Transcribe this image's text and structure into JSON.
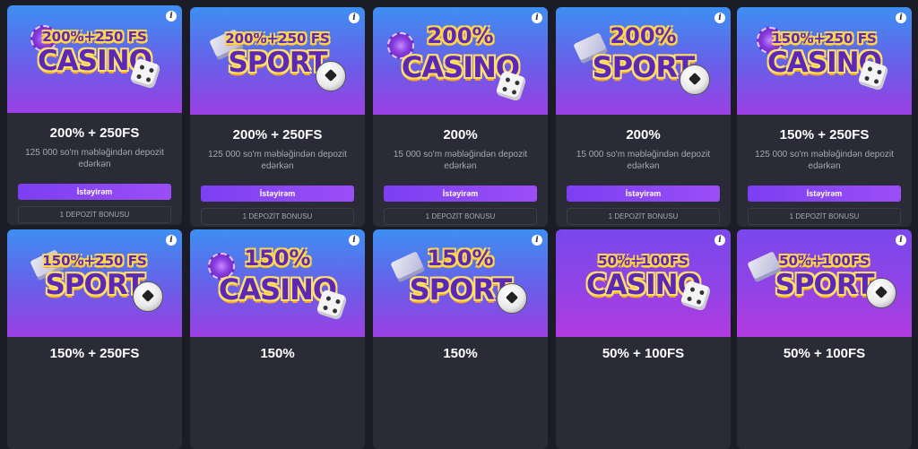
{
  "info_glyph": "i",
  "cards": [
    {
      "banner_top": "200%+250 FS",
      "banner_big": "CASINO",
      "title": "200% + 250FS",
      "desc": "125 000 so'm məbləğindən depozit edərkən",
      "button": "İstəyirəm",
      "tag": "1 DEPOZİT BONUSU"
    },
    {
      "banner_top": "200%+250 FS",
      "banner_big": "SPORT",
      "title": "200% + 250FS",
      "desc": "125 000 so'm məbləğindən depozit edərkən",
      "button": "İstəyirəm",
      "tag": "1 DEPOZİT BONUSU"
    },
    {
      "banner_top": "200%",
      "banner_big": "CASINO",
      "title": "200%",
      "desc": "15 000 so'm məbləğindən depozit edərkən",
      "button": "İstəyirəm",
      "tag": "1 DEPOZİT BONUSU"
    },
    {
      "banner_top": "200%",
      "banner_big": "SPORT",
      "title": "200%",
      "desc": "15 000 so'm məbləğindən depozit edərkən",
      "button": "İstəyirəm",
      "tag": "1 DEPOZİT BONUSU"
    },
    {
      "banner_top": "150%+250 FS",
      "banner_big": "CASINO",
      "title": "150% + 250FS",
      "desc": "125 000 so'm məbləğindən depozit edərkən",
      "button": "İstəyirəm",
      "tag": "1 DEPOZİT BONUSU"
    },
    {
      "banner_top": "150%+250 FS",
      "banner_big": "SPORT",
      "title": "150% + 250FS"
    },
    {
      "banner_top": "150%",
      "banner_big": "CASINO",
      "title": "150%"
    },
    {
      "banner_top": "150%",
      "banner_big": "SPORT",
      "title": "150%"
    },
    {
      "banner_top": "50%+100FS",
      "banner_big": "CASINO",
      "title": "50% + 100FS"
    },
    {
      "banner_top": "50%+100FS",
      "banner_big": "SPORT",
      "title": "50% + 100FS"
    }
  ]
}
